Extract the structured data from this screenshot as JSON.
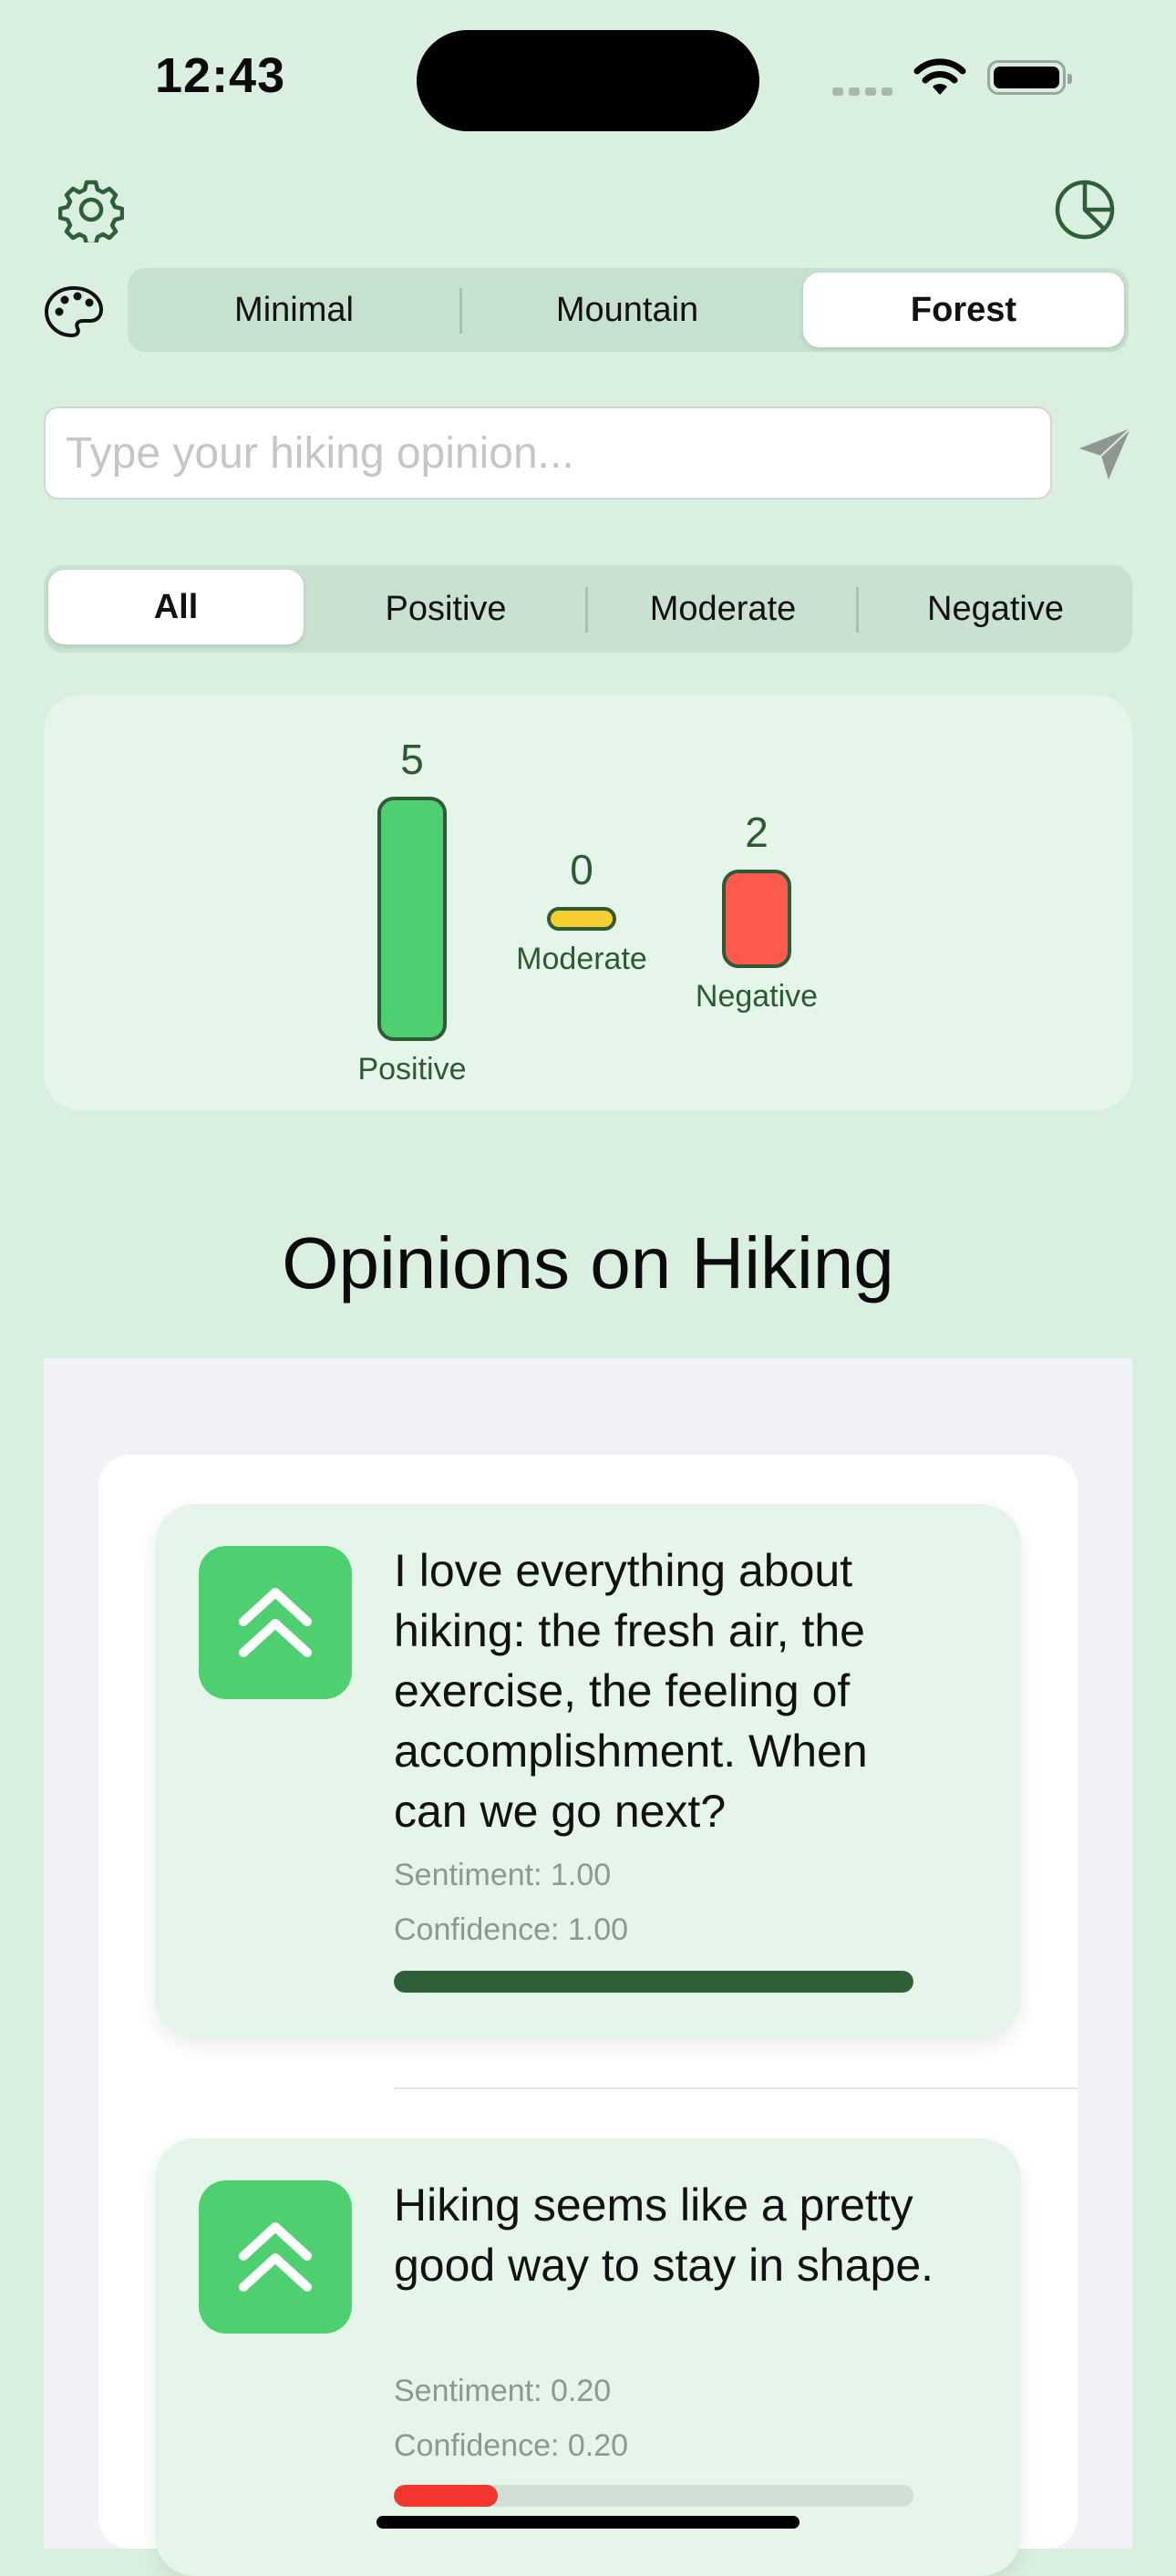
{
  "status_bar": {
    "time": "12:43"
  },
  "theme_selector": {
    "options": [
      "Minimal",
      "Mountain",
      "Forest"
    ],
    "selected": "Forest"
  },
  "input": {
    "placeholder": "Type your hiking opinion..."
  },
  "filter": {
    "options": [
      "All",
      "Positive",
      "Moderate",
      "Negative"
    ],
    "selected": "All"
  },
  "chart_data": {
    "type": "bar",
    "categories": [
      "Positive",
      "Moderate",
      "Negative"
    ],
    "values": [
      5,
      0,
      2
    ],
    "colors": [
      "#4fd070",
      "#f5cf2f",
      "#fb5a4d"
    ],
    "title": "",
    "xlabel": "",
    "ylabel": ""
  },
  "section_title": "Opinions on Hiking",
  "opinions": [
    {
      "text": "I love everything about hiking: the fresh air, the exercise, the feeling of accomplishment. When can we go next?",
      "sentiment_label": "Sentiment: 1.00",
      "confidence_label": "Confidence: 1.00",
      "progress": 1.0,
      "bar_color": "#2e5f37",
      "icon": "chevron-double-up-icon"
    },
    {
      "text": "Hiking seems like a pretty good way to stay in shape.",
      "sentiment_label": "Sentiment: 0.20",
      "confidence_label": "Confidence: 0.20",
      "progress": 0.2,
      "bar_color": "#f4362f",
      "icon": "chevron-double-up-icon"
    }
  ],
  "colors": {
    "background": "#d9efdf",
    "accent": "#2e5f37",
    "positive": "#4fd070"
  }
}
